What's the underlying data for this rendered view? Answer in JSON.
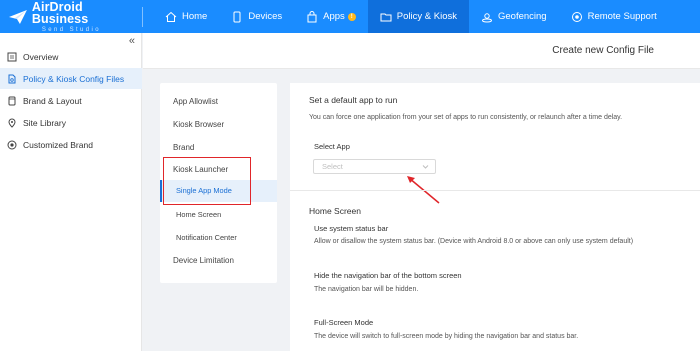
{
  "brand": {
    "name": "AirDroid Business",
    "sub": "Send Studio"
  },
  "topnav": [
    {
      "label": "Home",
      "icon": "home-icon"
    },
    {
      "label": "Devices",
      "icon": "device-icon"
    },
    {
      "label": "Apps",
      "icon": "apps-icon",
      "badge": "!"
    },
    {
      "label": "Policy & Kiosk",
      "icon": "folder-icon",
      "active": true
    },
    {
      "label": "Geofencing",
      "icon": "geofence-icon"
    },
    {
      "label": "Remote Support",
      "icon": "remote-support-icon"
    }
  ],
  "sidebar": {
    "items": [
      {
        "label": "Overview",
        "icon": "overview-icon"
      },
      {
        "label": "Policy & Kiosk Config Files",
        "icon": "config-file-icon",
        "active": true
      },
      {
        "label": "Brand & Layout",
        "icon": "brand-layout-icon"
      },
      {
        "label": "Site Library",
        "icon": "site-library-icon"
      },
      {
        "label": "Customized Brand",
        "icon": "customized-brand-icon"
      }
    ]
  },
  "header": {
    "title": "Create new Config File"
  },
  "subnav": {
    "items": [
      {
        "label": "App Allowlist"
      },
      {
        "label": "Kiosk Browser"
      },
      {
        "label": "Brand"
      },
      {
        "label": "Kiosk Launcher"
      },
      {
        "label": "Single App Mode",
        "active": true
      },
      {
        "label": "Home Screen"
      },
      {
        "label": "Notification Center"
      },
      {
        "label": "Device Limitation"
      }
    ]
  },
  "content": {
    "default_app_title": "Set a default app to run",
    "default_app_desc": "You can force one application from your set of apps to run consistently, or relaunch after a time delay.",
    "select_app_label": "Select App",
    "select_placeholder": "Select",
    "home_screen_title": "Home Screen",
    "status_bar_title": "Use system status bar",
    "status_bar_desc": "Allow or disallow the system status bar. (Device with Android 8.0 or above can only use system default)",
    "nav_bar_title": "Hide the navigation bar of the bottom screen",
    "nav_bar_desc": "The navigation bar will be hidden.",
    "fullscreen_title": "Full-Screen Mode",
    "fullscreen_desc": "The device will switch to full-screen mode by hiding the navigation bar and status bar."
  },
  "colors": {
    "topbar": "#1a8cff",
    "active_nav": "#0f6fdc",
    "accent": "#1a6fd4",
    "highlight_box": "#e0262a",
    "badge": "#ffb81c"
  }
}
